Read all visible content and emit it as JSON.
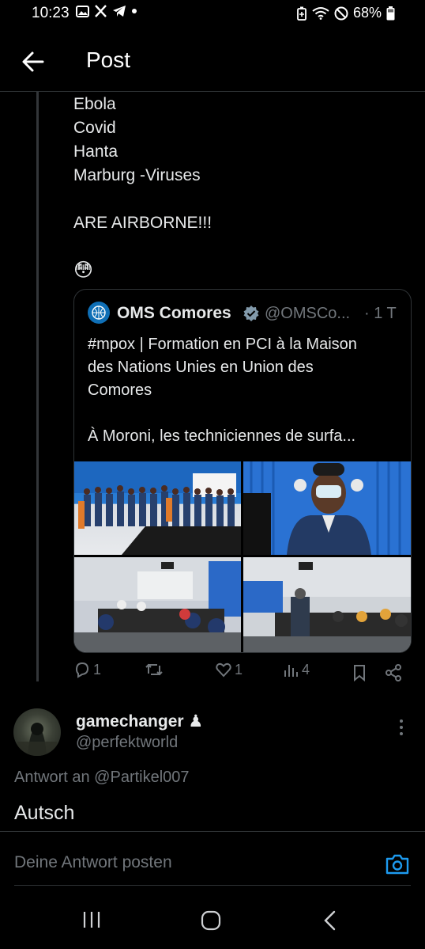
{
  "status_bar": {
    "time": "10:23",
    "battery": "68%",
    "left_icons": [
      "gallery-icon",
      "x-icon",
      "telegram-icon",
      "dot-icon"
    ],
    "right_icons": [
      "battery-saver-icon",
      "wifi-icon",
      "do-not-disturb-icon",
      "battery-icon"
    ]
  },
  "header": {
    "title": "Post"
  },
  "tweet": {
    "lines": [
      "Ebola",
      "Covid",
      "Hanta",
      "Marburg -Viruses",
      "",
      "ARE AIRBORNE!!!",
      "",
      "😳"
    ]
  },
  "quote": {
    "name": "OMS Comores",
    "handle": "@OMSCo...",
    "time": "· 1 T",
    "lines": [
      "#mpox | Formation en PCI à la Maison",
      "des Nations Unies en Union des",
      "Comores",
      "",
      "À Moroni, les techniciennes de surfa..."
    ]
  },
  "actions": {
    "replies": "1",
    "reposts": "",
    "likes": "1",
    "views": "4"
  },
  "reply": {
    "name": "gamechanger",
    "name_emoji": "♟",
    "handle": "@perfektworld",
    "reply_to_prefix": "Antwort an",
    "reply_to_handle": "@Partikel007",
    "text": "Autsch"
  },
  "composer": {
    "placeholder": "Deine Antwort posten"
  },
  "colors": {
    "background": "#000000",
    "text": "#e7e9ea",
    "muted": "#71767b",
    "divider": "#2f3336",
    "accent": "#1d9bf0",
    "verified": "#829aab"
  }
}
